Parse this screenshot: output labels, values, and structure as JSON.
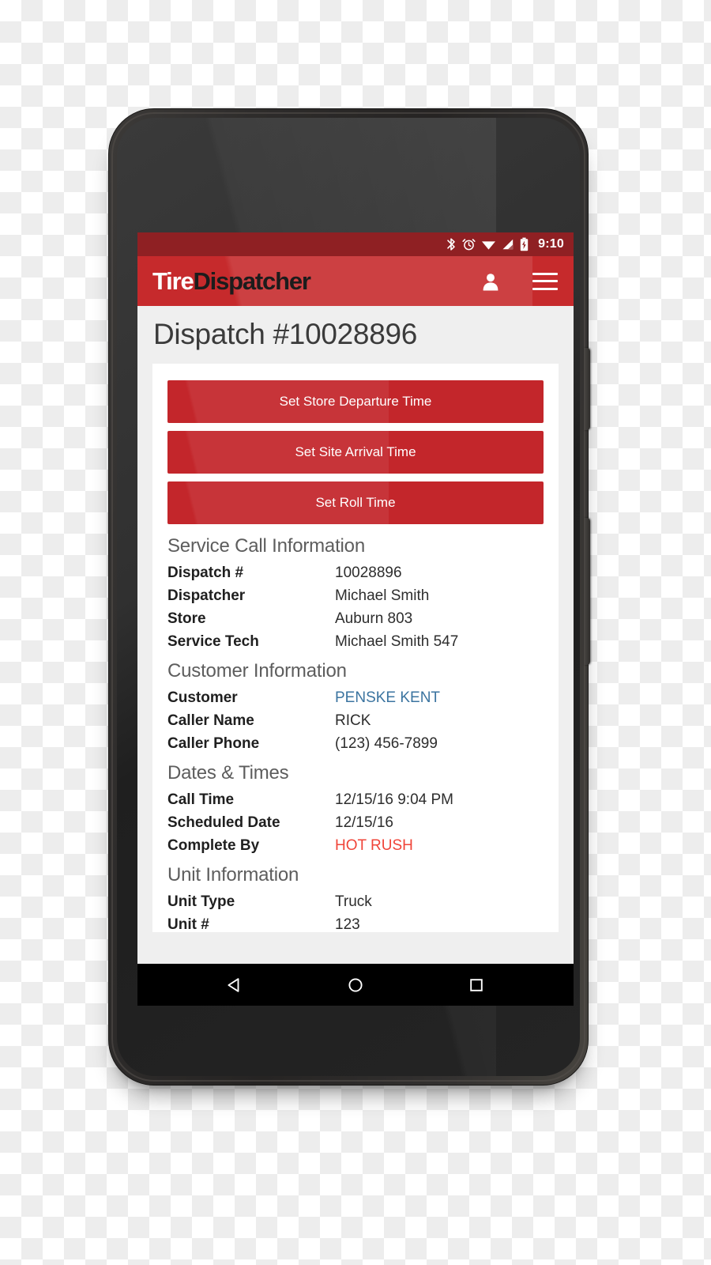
{
  "device": {
    "hardware": {
      "camera": "front-camera",
      "earpiece": "earpiece-speaker",
      "sensor": "proximity-sensor",
      "power_button": "power-button",
      "volume_button": "volume-rocker"
    }
  },
  "status_bar": {
    "time": "9:10",
    "icons": [
      "bluetooth-icon",
      "alarm-icon",
      "wifi-icon",
      "cell-signal-icon",
      "battery-charging-icon"
    ],
    "background_color": "#8f2023"
  },
  "app_bar": {
    "brand_part_1": "Tire",
    "brand_part_2": "Dispatcher",
    "background_color": "#c62a2c",
    "account_icon_label": "account-icon",
    "menu_icon_label": "menu-icon"
  },
  "page": {
    "title": "Dispatch #10028896",
    "accent_color": "#c3262b",
    "link_color": "#3b74a0",
    "alert_color": "#f04438"
  },
  "actions": [
    {
      "label": "Set Store Departure Time"
    },
    {
      "label": "Set Site Arrival Time"
    },
    {
      "label": "Set Roll Time"
    }
  ],
  "sections": [
    {
      "heading": "Service Call Information",
      "rows": [
        {
          "key": "Dispatch #",
          "value": "10028896",
          "style": "plain"
        },
        {
          "key": "Dispatcher",
          "value": "Michael Smith",
          "style": "plain"
        },
        {
          "key": "Store",
          "value": "Auburn 803",
          "style": "plain"
        },
        {
          "key": "Service Tech",
          "value": "Michael Smith 547",
          "style": "plain"
        }
      ]
    },
    {
      "heading": "Customer Information",
      "rows": [
        {
          "key": "Customer",
          "value": "PENSKE KENT",
          "style": "link"
        },
        {
          "key": "Caller Name",
          "value": "RICK",
          "style": "plain"
        },
        {
          "key": "Caller Phone",
          "value": "(123) 456-7899",
          "style": "plain"
        }
      ]
    },
    {
      "heading": "Dates & Times",
      "rows": [
        {
          "key": "Call Time",
          "value": "12/15/16 9:04 PM",
          "style": "plain"
        },
        {
          "key": "Scheduled Date",
          "value": "12/15/16",
          "style": "plain"
        },
        {
          "key": "Complete By",
          "value": "HOT RUSH",
          "style": "alert"
        }
      ]
    },
    {
      "heading": "Unit Information",
      "rows": [
        {
          "key": "Unit Type",
          "value": "Truck",
          "style": "plain"
        },
        {
          "key": "Unit #",
          "value": "123",
          "style": "plain"
        }
      ]
    }
  ],
  "nav_bar": {
    "back_label": "back-button",
    "home_label": "home-button",
    "recents_label": "recents-button"
  }
}
